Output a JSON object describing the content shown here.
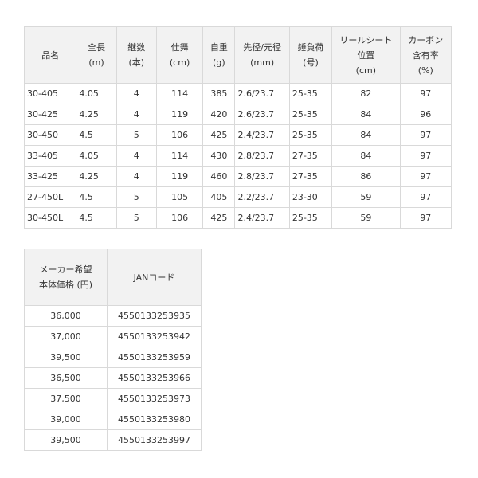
{
  "spec_table": {
    "headers": [
      [
        "品名"
      ],
      [
        "全長",
        "(m)"
      ],
      [
        "継数",
        "(本)"
      ],
      [
        "仕舞",
        "(cm)"
      ],
      [
        "自重",
        "(g)"
      ],
      [
        "先径/元径",
        "(mm)"
      ],
      [
        "錘負荷",
        "(号)"
      ],
      [
        "リールシート",
        "位置",
        "(cm)"
      ],
      [
        "カーボン",
        "含有率",
        "(%)"
      ]
    ],
    "rows": [
      [
        "30-405",
        "4.05",
        "4",
        "114",
        "385",
        "2.6/23.7",
        "25-35",
        "82",
        "97"
      ],
      [
        "30-425",
        "4.25",
        "4",
        "119",
        "420",
        "2.6/23.7",
        "25-35",
        "84",
        "96"
      ],
      [
        "30-450",
        "4.5",
        "5",
        "106",
        "425",
        "2.4/23.7",
        "25-35",
        "84",
        "97"
      ],
      [
        "33-405",
        "4.05",
        "4",
        "114",
        "430",
        "2.8/23.7",
        "27-35",
        "84",
        "97"
      ],
      [
        "33-425",
        "4.25",
        "4",
        "119",
        "460",
        "2.8/23.7",
        "27-35",
        "86",
        "97"
      ],
      [
        "27-450L",
        "4.5",
        "5",
        "105",
        "405",
        "2.2/23.7",
        "23-30",
        "59",
        "97"
      ],
      [
        "30-450L",
        "4.5",
        "5",
        "106",
        "425",
        "2.4/23.7",
        "25-35",
        "59",
        "97"
      ]
    ]
  },
  "price_table": {
    "headers": [
      [
        "メーカー希望",
        "本体価格 (円)"
      ],
      [
        "JANコード"
      ]
    ],
    "rows": [
      [
        "36,000",
        "4550133253935"
      ],
      [
        "37,000",
        "4550133253942"
      ],
      [
        "39,500",
        "4550133253959"
      ],
      [
        "36,500",
        "4550133253966"
      ],
      [
        "37,500",
        "4550133253973"
      ],
      [
        "39,000",
        "4550133253980"
      ],
      [
        "39,500",
        "4550133253997"
      ]
    ]
  }
}
